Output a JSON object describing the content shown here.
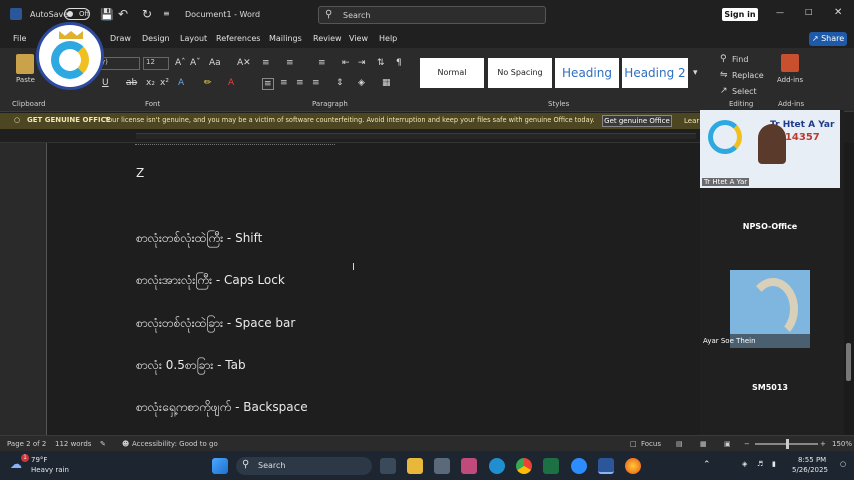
{
  "titlebar": {
    "autosave_label": "AutoSave",
    "autosave_state": "Off",
    "doc_title": "Document1 - Word",
    "search_placeholder": "Search",
    "signin_label": "Sign in"
  },
  "menu": {
    "items": [
      "File",
      "Draw",
      "Design",
      "Layout",
      "References",
      "Mailings",
      "Review",
      "View",
      "Help"
    ],
    "share_label": "Share"
  },
  "ribbon": {
    "font_size": "12",
    "groups": [
      "Clipboard",
      "Font",
      "Paragraph",
      "Styles",
      "Editing",
      "Add-ins"
    ],
    "paste_label": "Paste",
    "styles": [
      "Normal",
      "No Spacing",
      "Heading",
      "Heading 2"
    ],
    "editing": {
      "find": "Find",
      "replace": "Replace",
      "select": "Select"
    },
    "addins_label": "Add-ins"
  },
  "infobar": {
    "title": "GET GENUINE OFFICE",
    "message": "Your license isn't genuine, and you may be a victim of software counterfeiting. Avoid interruption and keep your files safe with genuine Office today.",
    "button": "Get genuine Office",
    "learn": "Lear"
  },
  "document": {
    "lines": [
      "Z",
      "စာလုံးတစ်လုံးထဲကြီး - Shift",
      "စာလုံးအားလုံးကြီး - Caps Lock",
      "စာလုံးတစ်လုံးထဲခြား - Space bar",
      "စာလုံး 0.5စာခြား - Tab",
      "စာလုံးရှေ့ကစာကိုဖျက် - Backspace"
    ]
  },
  "sidepanel": {
    "video_label": "Tr Htet A Yar",
    "overlay_text": "Tr Htet A Yar",
    "phone": "014357",
    "tiles": [
      "NPSO-Office",
      "Ayar Soe Thein",
      "SM5013"
    ]
  },
  "statusbar": {
    "page": "Page 2 of 2",
    "words": "112 words",
    "accessibility": "Accessibility: Good to go",
    "focus": "Focus",
    "zoom": "150%"
  },
  "taskbar": {
    "weather_temp": "79°F",
    "weather_desc": "Heavy rain",
    "search_label": "Search",
    "time": "8:55 PM",
    "date": "5/26/2025",
    "weather_badge": "1"
  },
  "colors": {
    "accent": "#1e5aa8",
    "infobar": "#4c4623",
    "word_blue": "#2b579a"
  }
}
